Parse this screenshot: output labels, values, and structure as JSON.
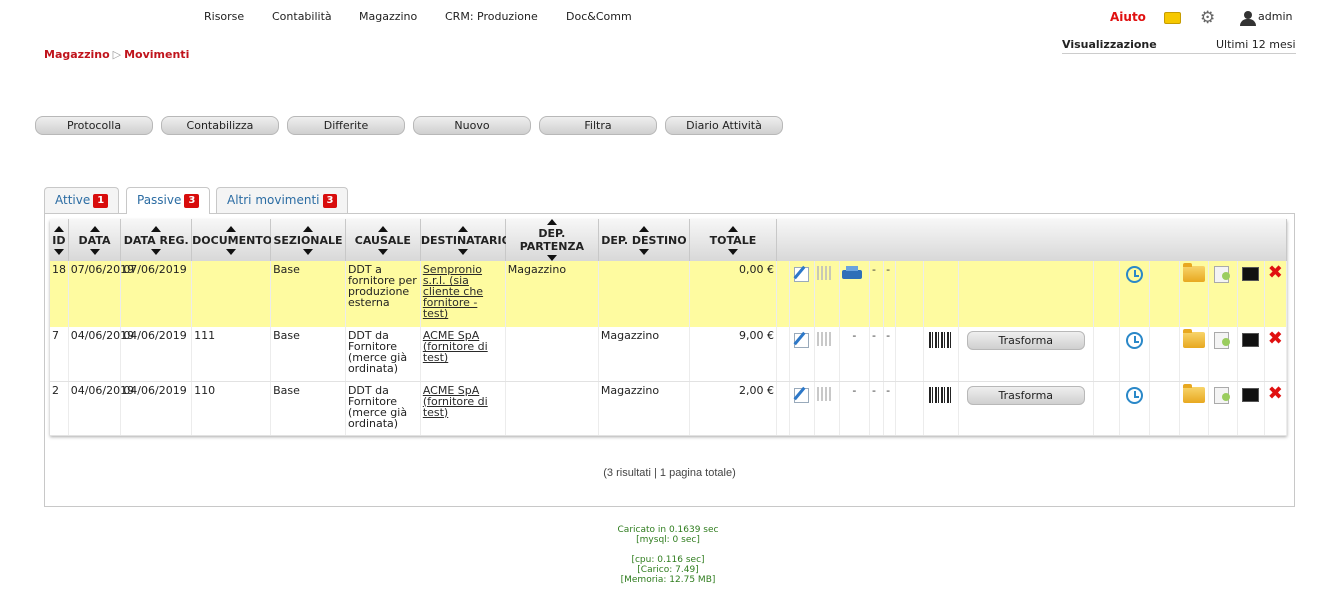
{
  "nav": {
    "items": [
      "Risorse",
      "Contabilità",
      "Magazzino",
      "CRM: Produzione",
      "Doc&Comm"
    ],
    "help": "Aiuto",
    "user": "admin"
  },
  "view": {
    "label": "Visualizzazione",
    "value": "Ultimi 12 mesi"
  },
  "breadcrumb": {
    "section": "Magazzino",
    "separator": "▷",
    "page": "Movimenti"
  },
  "toolbar": [
    "Protocolla",
    "Contabilizza",
    "Differite",
    "Nuovo",
    "Filtra",
    "Diario Attività"
  ],
  "tabs": [
    {
      "label": "Attive",
      "count": "1"
    },
    {
      "label": "Passive",
      "count": "3"
    },
    {
      "label": "Altri movimenti",
      "count": "3"
    }
  ],
  "table": {
    "headers": [
      "ID",
      "DATA",
      "DATA REG.",
      "DOCUMENTO",
      "SEZIONALE",
      "CAUSALE",
      "DESTINATARIO",
      "DEP. PARTENZA",
      "DEP. DESTINO",
      "TOTALE"
    ],
    "rows": [
      {
        "id": "18",
        "data": "07/06/2019",
        "data_reg": "07/06/2019",
        "documento": "",
        "sezionale": "Base",
        "causale": "DDT a fornitore per produzione esterna",
        "destinatario": "Sempronio s.r.l. (sia cliente che fornitore - test)",
        "dep_partenza": "Magazzino",
        "dep_destino": "",
        "totale": "0,00 €",
        "dash1": "-",
        "dash2": "-",
        "highlight": true
      },
      {
        "id": "7",
        "data": "04/06/2019",
        "data_reg": "04/06/2019",
        "documento": "111",
        "sezionale": "Base",
        "causale": "DDT da Fornitore (merce già ordinata)",
        "destinatario": "ACME SpA (fornitore di test)",
        "dep_partenza": "",
        "dep_destino": "Magazzino",
        "totale": "9,00 €",
        "dash1": "-",
        "dash2": "-",
        "dash3": "-",
        "action": "Trasforma"
      },
      {
        "id": "2",
        "data": "04/06/2019",
        "data_reg": "04/06/2019",
        "documento": "110",
        "sezionale": "Base",
        "causale": "DDT da Fornitore (merce già ordinata)",
        "destinatario": "ACME SpA (fornitore di test)",
        "dep_partenza": "",
        "dep_destino": "Magazzino",
        "totale": "2,00 €",
        "dash1": "-",
        "dash2": "-",
        "dash3": "-",
        "action": "Trasforma"
      }
    ]
  },
  "pager": "(3 risultati | 1 pagina totale)",
  "footer": {
    "loaded": "Caricato in 0.1639 sec",
    "mysql": "[mysql: 0 sec]",
    "cpu": "[cpu: 0.116 sec]",
    "load": "[Carico: 7.49]",
    "memory": "[Memoria: 12.75 MB]"
  },
  "colors": {
    "accent_red": "#c0141c",
    "highlight_row": "#fefba0",
    "footer_green": "#2f7d1e",
    "tab_blue": "#2b6ca3"
  }
}
